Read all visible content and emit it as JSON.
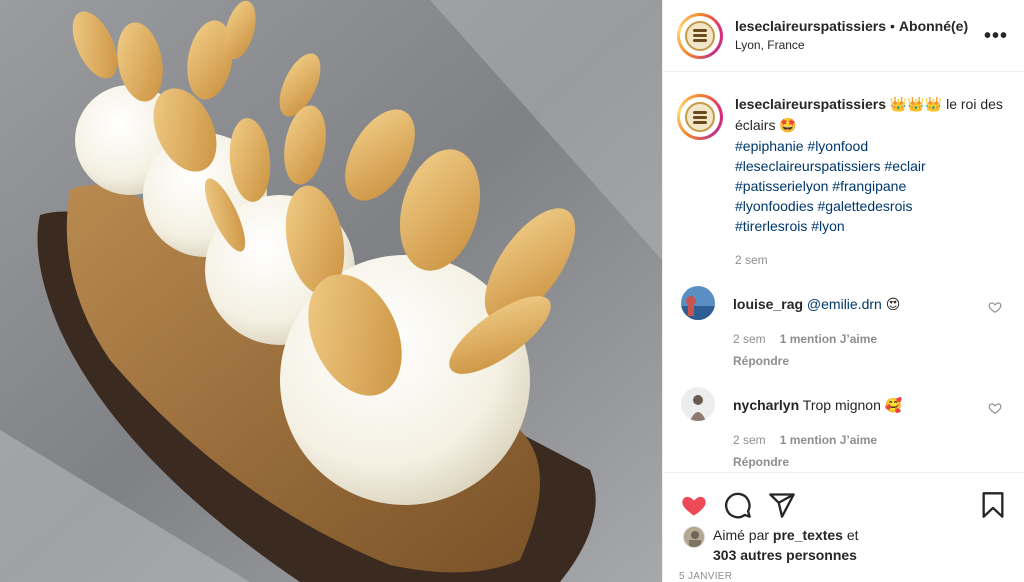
{
  "post": {
    "username": "leseclaireurspatissiers",
    "separator": "•",
    "follow_status": "Abonné(e)",
    "location": "Lyon, France",
    "more_label": "•••"
  },
  "caption": {
    "username": "leseclaireurspatissiers",
    "emojis": "👑👑👑",
    "text": "le roi des éclairs",
    "end_emoji": "🤩",
    "hashtags": [
      "#epiphanie",
      "#lyonfood",
      "#leseclaireurspatissiers",
      "#eclair",
      "#patisserielyon",
      "#frangipane",
      "#lyonfoodies",
      "#galettedesrois",
      "#tirerlesrois",
      "#lyon"
    ],
    "time": "2 sem"
  },
  "comments": [
    {
      "username": "louise_rag",
      "text": "@emilie.drn",
      "emoji": "😍",
      "time": "2 sem",
      "likes": "1 mention J’aime",
      "reply": "Répondre"
    },
    {
      "username": "nycharlyn",
      "text": "Trop mignon",
      "emoji": "🥰",
      "time": "2 sem",
      "likes": "1 mention J’aime",
      "reply": "Répondre"
    }
  ],
  "likes": {
    "prefix": "Aimé par",
    "user": "pre_textes",
    "conj": "et",
    "others": "303 autres personnes"
  },
  "date": "5 JANVIER",
  "colors": {
    "like_red": "#ed4956",
    "link_blue": "#00376b",
    "muted": "#8e8e8e"
  },
  "icons": [
    "heart-icon",
    "comment-icon",
    "share-icon",
    "bookmark-icon",
    "small-heart-icon"
  ]
}
